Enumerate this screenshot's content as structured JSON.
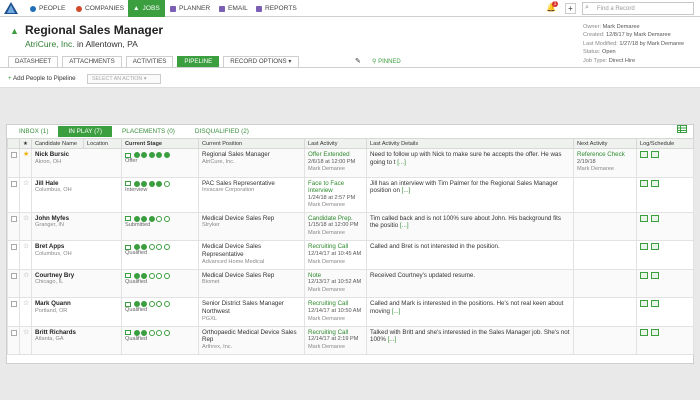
{
  "nav": {
    "items": [
      {
        "label": "PEOPLE",
        "color": "#1f6fb5"
      },
      {
        "label": "COMPANIES",
        "color": "#d14b2b"
      },
      {
        "label": "JOBS",
        "color": "#3b9e3f"
      },
      {
        "label": "PLANNER",
        "color": "#7a5fb5"
      },
      {
        "label": "EMAIL",
        "color": "#7a5fb5"
      },
      {
        "label": "REPORTS",
        "color": "#7a5fb5"
      }
    ],
    "notification_count": "1",
    "search_placeholder": "Find a Record"
  },
  "header": {
    "title": "Regional Sales Manager",
    "company": "AtriCure, Inc.",
    "location": "in Allentown, PA",
    "meta": [
      {
        "label": "Owner:",
        "value": "Mark Demaree"
      },
      {
        "label": "Created:",
        "value": "12/8/17 by Mark Demaree"
      },
      {
        "label": "Last Modified:",
        "value": "1/27/18 by Mark Demaree"
      },
      {
        "label": "Status:",
        "value": "Open"
      },
      {
        "label": "Job Type:",
        "value": "Direct Hire"
      }
    ],
    "tabs": [
      "DATASHEET",
      "ATTACHMENTS",
      "ACTIVITIES",
      "PIPELINE",
      "RECORD OPTIONS"
    ],
    "pinned": "PINNED"
  },
  "actions": {
    "add_people": "Add People to Pipeline",
    "select_action": "SELECT AN ACTION"
  },
  "pipeline": {
    "tabs": [
      "INBOX (1)",
      "IN PLAY (7)",
      "PLACEMENTS (0)",
      "DISQUALIFIED (2)"
    ],
    "columns": [
      "Candidate Name",
      "Location",
      "Current Stage",
      "Current Position",
      "Last Activity",
      "Last Activity Details",
      "Next Activity",
      "Log/Schedule"
    ],
    "rows": [
      {
        "name": "Nick Bursic",
        "loc": "Akron, OH",
        "gold": true,
        "stage": "Offer",
        "level": 5,
        "position": "Regional Sales Manager",
        "company": "AtriCure, Inc.",
        "act": "Offer Extended",
        "date": "2/6/18",
        "time": "at 12:00 PM",
        "who": "Mark Demaree",
        "details": "Need to follow up with Nick to make sure he accepts the offer. He was going to t",
        "more": "[...]",
        "next": "Reference Check",
        "next_date": "2/19/18",
        "next_who": "Mark Demaree"
      },
      {
        "name": "Jill Hale",
        "loc": "Columbus, OH",
        "gold": false,
        "stage": "Interview",
        "level": 4,
        "position": "PAC Sales Representative",
        "company": "Invacare Corporation",
        "act": "Face to Face Interview",
        "date": "1/24/18",
        "time": "at 2:57 PM",
        "who": "Mark Demaree",
        "details": "Jill has an interview with Tim Palmer for the Regional Sales Manager position on",
        "more": "[...]",
        "next": "",
        "next_date": "",
        "next_who": ""
      },
      {
        "name": "John Myfes",
        "loc": "Granger, IN",
        "gold": false,
        "stage": "Submitted",
        "level": 3,
        "position": "Medical Device Sales Rep",
        "company": "Stryker",
        "act": "Candidate Prep.",
        "date": "1/15/18",
        "time": "at 12:00 PM",
        "who": "Mark Demaree",
        "details": "Tim called back and is not 100% sure about John. His background fits the positio",
        "more": "[...]",
        "next": "",
        "next_date": "",
        "next_who": ""
      },
      {
        "name": "Bret Apps",
        "loc": "Columbus, OH",
        "gold": false,
        "stage": "Qualified",
        "level": 2,
        "position": "Medical Device Sales Representative",
        "company": "Advanced Home Medical",
        "act": "Recruiting Call",
        "date": "12/14/17",
        "time": "at 10:45 AM",
        "who": "Mark Demaree",
        "details": "Called and Bret is not interested in the position.",
        "more": "",
        "next": "",
        "next_date": "",
        "next_who": ""
      },
      {
        "name": "Courtney Bry",
        "loc": "Chicago, IL",
        "gold": false,
        "stage": "Qualified",
        "level": 2,
        "position": "Medical Device Sales Rep",
        "company": "Biomet",
        "act": "Note",
        "date": "12/13/17",
        "time": "at 10:52 AM",
        "who": "Mark Demaree",
        "details": "Received Courtney's updated resume.",
        "more": "",
        "next": "",
        "next_date": "",
        "next_who": ""
      },
      {
        "name": "Mark Quann",
        "loc": "Portland, OR",
        "gold": false,
        "stage": "Qualified",
        "level": 2,
        "position": "Senior District Sales Manager Northwest",
        "company": "PGXL",
        "act": "Recruiting Call",
        "date": "12/14/17",
        "time": "at 10:50 AM",
        "who": "Mark Demaree",
        "details": "Called and Mark is interested in the positions. He's not real keen about moving",
        "more": "[...]",
        "next": "",
        "next_date": "",
        "next_who": ""
      },
      {
        "name": "Britt Richards",
        "loc": "Atlanta, GA",
        "gold": false,
        "stage": "Qualified",
        "level": 2,
        "position": "Orthopaedic Medical Device Sales Rep",
        "company": "Arthrex, Inc.",
        "act": "Recruiting Call",
        "date": "12/14/17",
        "time": "at 2:19 PM",
        "who": "Mark Demaree",
        "details": "Talked with Britt and she's interested in the Sales Manager job. She's not 100%",
        "more": "[...]",
        "next": "",
        "next_date": "",
        "next_who": ""
      }
    ]
  },
  "colors": {
    "accent": "#3b9e3f",
    "link": "#2e8b2e"
  }
}
